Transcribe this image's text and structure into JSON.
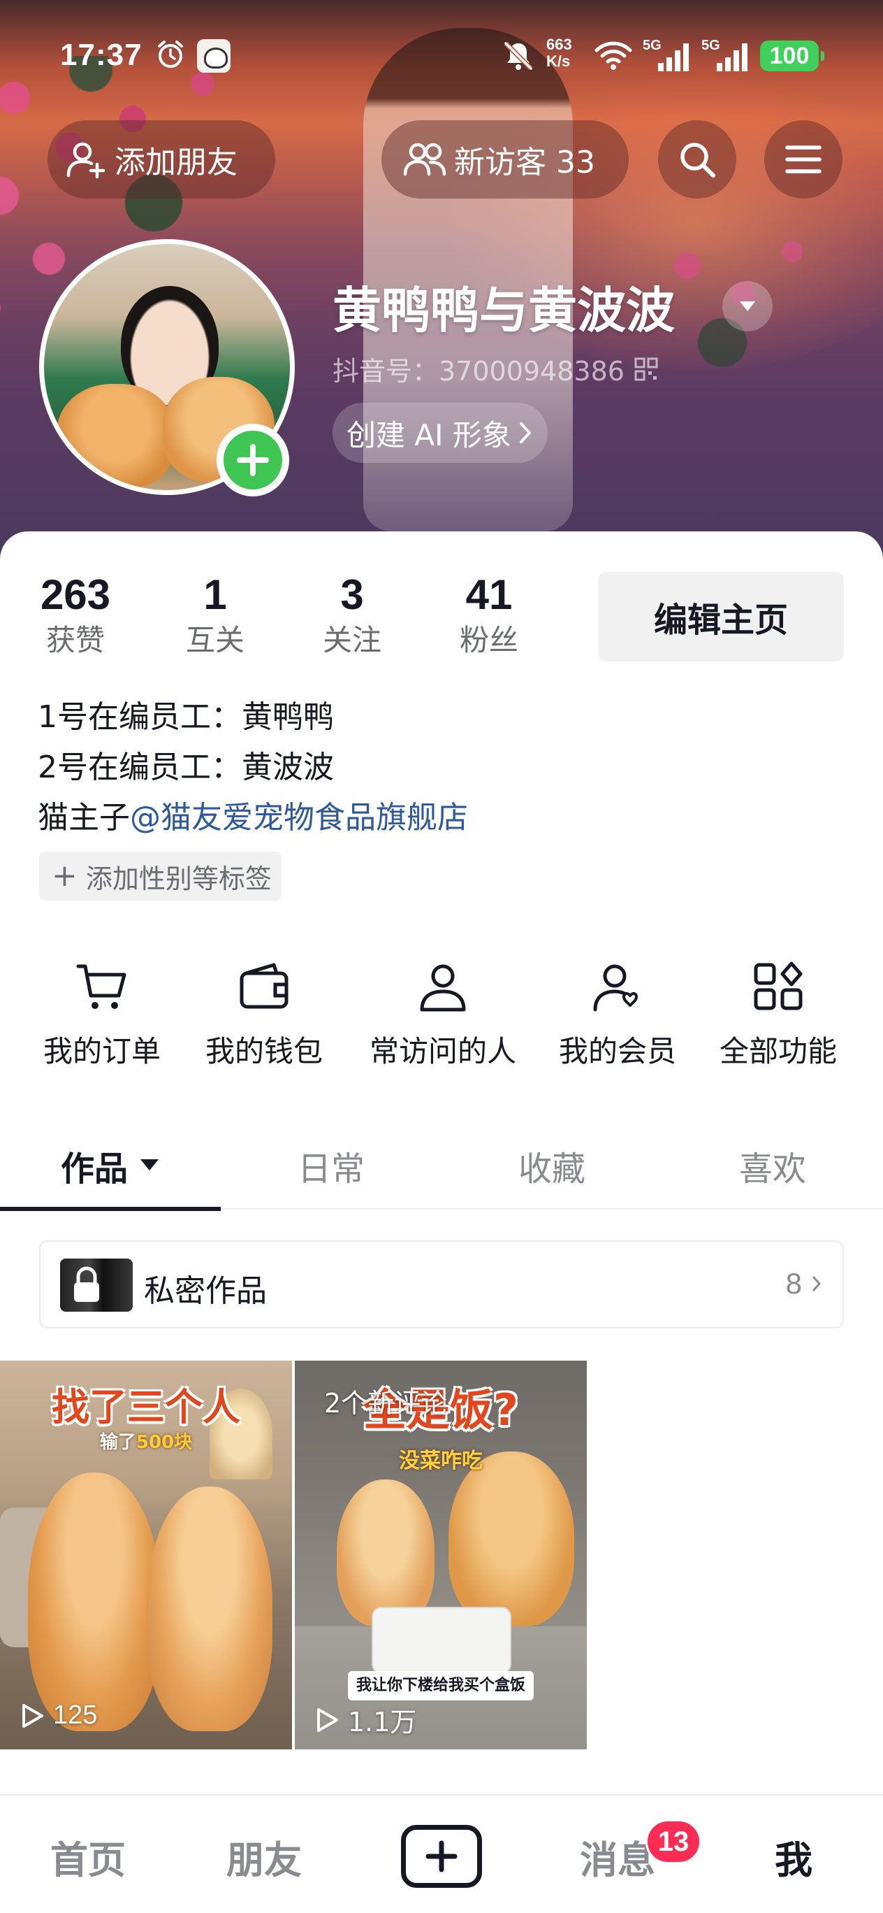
{
  "status_bar": {
    "time": "17:37",
    "net_speed_value": "663",
    "net_speed_unit": "K/s",
    "signal_1_label": "5G",
    "signal_2_label": "5G",
    "battery": "100"
  },
  "header": {
    "add_friend_label": "添加朋友",
    "visitors_label": "新访客 33"
  },
  "profile": {
    "name": "黄鸭鸭与黄波波",
    "douyin_id": "抖音号：37000948386",
    "ai_button_label": "创建 AI 形象"
  },
  "stats": [
    {
      "value": "263",
      "label": "获赞"
    },
    {
      "value": "1",
      "label": "互关"
    },
    {
      "value": "3",
      "label": "关注"
    },
    {
      "value": "41",
      "label": "粉丝"
    }
  ],
  "edit_profile_label": "编辑主页",
  "bio": {
    "line1": "1号在编员工：黄鸭鸭",
    "line2": "2号在编员工：黄波波",
    "line3_prefix": "猫主子",
    "line3_mention": "@猫友爱宠物食品旗舰店"
  },
  "add_tag_label": "添加性别等标签",
  "features": [
    {
      "label": "我的订单",
      "icon": "cart-icon"
    },
    {
      "label": "我的钱包",
      "icon": "wallet-icon"
    },
    {
      "label": "常访问的人",
      "icon": "person-icon"
    },
    {
      "label": "我的会员",
      "icon": "member-icon"
    },
    {
      "label": "全部功能",
      "icon": "grid-icon"
    }
  ],
  "tabs": [
    {
      "label": "作品",
      "active": true
    },
    {
      "label": "日常",
      "active": false
    },
    {
      "label": "收藏",
      "active": false
    },
    {
      "label": "喜欢",
      "active": false
    }
  ],
  "private_works": {
    "label": "私密作品",
    "count": "8"
  },
  "videos": [
    {
      "title": "找了三个人",
      "subtitle_prefix": "输了",
      "subtitle_highlight": "500块",
      "plays": "125"
    },
    {
      "comment_badge": "2个新评论",
      "title": "全是饭?",
      "subtitle": "没菜咋吃",
      "caption": "我让你下楼给我买个盒饭",
      "plays": "1.1万"
    }
  ],
  "bottom_nav": {
    "home": "首页",
    "friends": "朋友",
    "messages": "消息",
    "messages_badge": "13",
    "me": "我"
  },
  "colors": {
    "accent_red": "#fe2c55",
    "add_green": "#3ec552",
    "mention_blue": "#2e5a9c",
    "battery_green": "#3ed05a"
  }
}
